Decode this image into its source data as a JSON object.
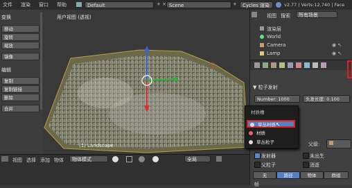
{
  "topbar": {
    "menus": [
      "文件",
      "渲染",
      "窗口",
      "帮助"
    ],
    "layout": "Default",
    "scene": "Scene",
    "engine": "Cycles 渲染",
    "version": "v2.77 | Verts:12,740 | Face"
  },
  "left_panel": {
    "section1": "变换",
    "buttons1": [
      "移动",
      "旋转",
      "缩放"
    ],
    "extra1": "镜像",
    "section2": "编辑",
    "buttons2": [
      "复制",
      "复制链接",
      "删除",
      "合并"
    ]
  },
  "viewport": {
    "title": "用户视图 (透视)",
    "object_label": "(1) Landscape"
  },
  "bottombar": {
    "menus": [
      "视图",
      "选择",
      "添加",
      "物体"
    ],
    "mode": "物体模式",
    "pivot": "全局"
  },
  "outliner": {
    "header_items": [
      "视图",
      "搜索",
      "所有场景"
    ],
    "rows": [
      "渲染层",
      "World",
      "Camera",
      "Lamp"
    ]
  },
  "properties": {
    "section": "▼ 粒子发射",
    "number_label": "Number:",
    "number_value": "1000",
    "length_label": "头发长度:",
    "length_value": "0.100",
    "dropdown_title": "材质槽",
    "dropdown_items": [
      "草丛材质",
      "材质",
      "草丛粒子"
    ],
    "parent_label": "父级:",
    "checkboxes": [
      "发射器",
      "父粒子"
    ],
    "checkboxes_right": [
      "未出生",
      "消逝"
    ],
    "tabs": [
      "无",
      "路径",
      "物体",
      "群组"
    ],
    "tab_active": 1,
    "frame_field": "帧"
  }
}
